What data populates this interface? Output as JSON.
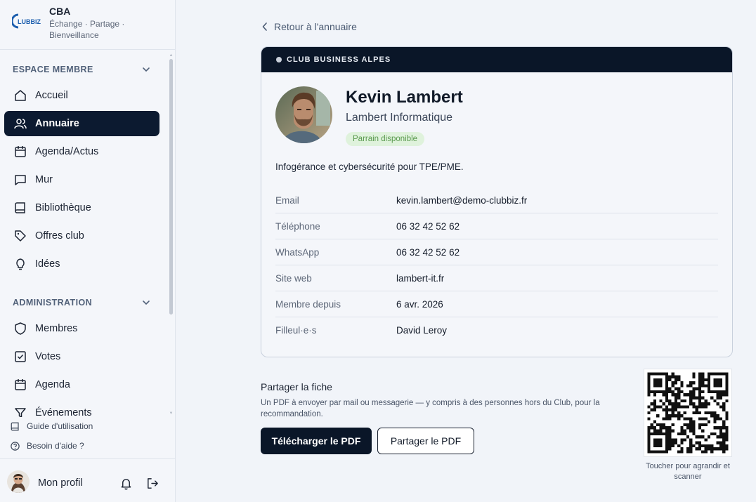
{
  "brand": {
    "logo_text": "CLUBBIZ",
    "name": "CBA",
    "tagline": "Échange · Partage · Bienveillance"
  },
  "sidebar": {
    "sections": [
      {
        "title": "ESPACE MEMBRE",
        "items": [
          {
            "label": "Accueil",
            "icon": "home-icon",
            "active": false
          },
          {
            "label": "Annuaire",
            "icon": "users-icon",
            "active": true
          },
          {
            "label": "Agenda/Actus",
            "icon": "calendar-icon",
            "active": false
          },
          {
            "label": "Mur",
            "icon": "message-square-icon",
            "active": false
          },
          {
            "label": "Bibliothèque",
            "icon": "book-icon",
            "active": false
          },
          {
            "label": "Offres club",
            "icon": "tag-icon",
            "active": false
          },
          {
            "label": "Idées",
            "icon": "lightbulb-icon",
            "active": false
          }
        ]
      },
      {
        "title": "ADMINISTRATION",
        "items": [
          {
            "label": "Membres",
            "icon": "shield-icon",
            "active": false
          },
          {
            "label": "Votes",
            "icon": "checkbox-icon",
            "active": false
          },
          {
            "label": "Agenda",
            "icon": "calendar-icon",
            "active": false
          },
          {
            "label": "Événements",
            "icon": "filter-icon",
            "active": false
          }
        ]
      }
    ],
    "footer_links": [
      {
        "label": "Guide d'utilisation",
        "icon": "book-icon"
      },
      {
        "label": "Besoin d'aide ?",
        "icon": "help-circle-icon"
      }
    ],
    "profile": {
      "label": "Mon profil"
    }
  },
  "main": {
    "back_label": "Retour à l'annuaire",
    "card": {
      "header": "CLUB BUSINESS ALPES",
      "name": "Kevin Lambert",
      "company": "Lambert Informatique",
      "badge": "Parrain disponible",
      "description": "Infogérance et cybersécurité pour TPE/PME.",
      "fields": [
        {
          "label": "Email",
          "value": "kevin.lambert@demo-clubbiz.fr"
        },
        {
          "label": "Téléphone",
          "value": "06 32 42 52 62"
        },
        {
          "label": "WhatsApp",
          "value": "06 32 42 52 62"
        },
        {
          "label": "Site web",
          "value": "lambert-it.fr"
        },
        {
          "label": "Membre depuis",
          "value": "6 avr. 2026"
        },
        {
          "label": "Filleul·e·s",
          "value": "David Leroy"
        }
      ]
    },
    "share": {
      "title": "Partager la fiche",
      "description": "Un PDF à envoyer par mail ou messagerie — y compris à des personnes hors du Club, pour la recommandation.",
      "download_label": "Télécharger le PDF",
      "share_label": "Partager le PDF",
      "qr_caption": "Toucher pour agrandir et scanner"
    }
  },
  "colors": {
    "navy": "#0a1628",
    "background": "#f1f4f9",
    "badge_bg": "#dff2dc",
    "badge_text": "#5a9a4e"
  }
}
